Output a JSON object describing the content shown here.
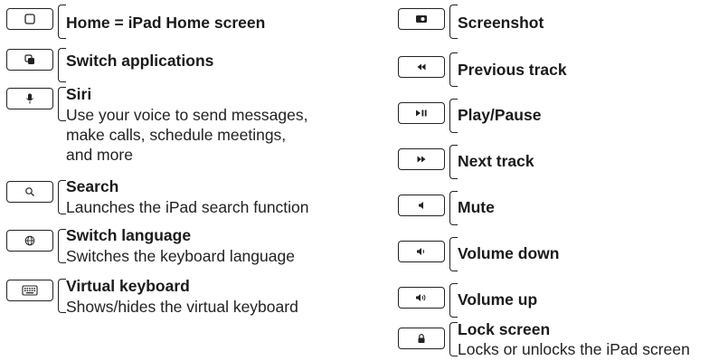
{
  "left": [
    {
      "title": "Home = iPad Home screen",
      "icon": "home-square-icon"
    },
    {
      "title": "Switch applications",
      "icon": "switch-apps-icon"
    },
    {
      "title": "Siri",
      "desc": [
        "Use your voice to send messages,",
        "make calls, schedule meetings,",
        "and more"
      ],
      "icon": "microphone-icon"
    },
    {
      "title": "Search",
      "desc": [
        "Launches the iPad search function"
      ],
      "icon": "search-icon"
    },
    {
      "title": "Switch language",
      "desc": [
        "Switches the keyboard language"
      ],
      "icon": "globe-icon"
    },
    {
      "title": "Virtual keyboard",
      "desc": [
        "Shows/hides the virtual keyboard"
      ],
      "icon": "keyboard-icon"
    }
  ],
  "right": [
    {
      "title": "Screenshot",
      "icon": "screenshot-icon"
    },
    {
      "title": "Previous track",
      "icon": "previous-track-icon"
    },
    {
      "title": "Play/Pause",
      "icon": "play-pause-icon"
    },
    {
      "title": "Next track",
      "icon": "next-track-icon"
    },
    {
      "title": "Mute",
      "icon": "mute-icon"
    },
    {
      "title": "Volume down",
      "icon": "volume-down-icon"
    },
    {
      "title": "Volume up",
      "icon": "volume-up-icon"
    },
    {
      "title": "Lock screen",
      "desc": [
        "Locks or unlocks the iPad screen"
      ],
      "icon": "lock-icon"
    }
  ]
}
